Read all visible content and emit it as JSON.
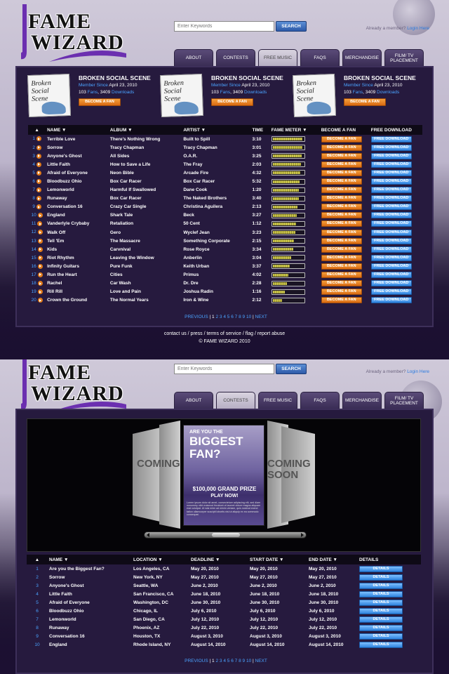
{
  "brand": {
    "line1": "FAME",
    "line2": "WIZARD"
  },
  "search": {
    "placeholder": "Enter Keywords",
    "button": "SEARCH"
  },
  "member": {
    "text": "Already a member?",
    "login": "Login Here"
  },
  "tabs": [
    {
      "label": "ABOUT"
    },
    {
      "label": "CONTESTS"
    },
    {
      "label": "FREE MUSIC"
    },
    {
      "label": "FAQS"
    },
    {
      "label": "MERCHANDISE"
    },
    {
      "label": "FILM/ TV PLACEMENT"
    }
  ],
  "music_page": {
    "active_tab": 2,
    "featured": [
      {
        "name": "BROKEN SOCIAL SCENE",
        "since_label": "Member Since",
        "since_date": "April 23, 2010",
        "fans": "103",
        "fans_label": "Fans",
        "downloads": "3409",
        "downloads_label": "Downloads",
        "button": "BECOME A FAN",
        "cover_text": "Broken Social Scene"
      },
      {
        "name": "BROKEN SOCIAL SCENE",
        "since_label": "Member Since",
        "since_date": "April 23, 2010",
        "fans": "103",
        "fans_label": "Fans",
        "downloads": "3409",
        "downloads_label": "Downloads",
        "button": "BECOME A FAN",
        "cover_text": "Broken Social Scene"
      },
      {
        "name": "BROKEN SOCIAL SCENE",
        "since_label": "Member Since",
        "since_date": "April 23, 2010",
        "fans": "103",
        "fans_label": "Fans",
        "downloads": "3409",
        "downloads_label": "Downloads",
        "button": "BECOME A FAN",
        "cover_text": "Broken Social Scene"
      }
    ],
    "columns": [
      "▲",
      "NAME ▼",
      "ALBUM ▼",
      "ARTIST ▼",
      "TIME",
      "FAME METER ▼",
      "BECOME A FAN",
      "FREE DOWNLOAD"
    ],
    "fan_button": "BECOME A FAN",
    "download_button": "FREE DOWNLOAD",
    "rows": [
      {
        "n": "1",
        "name": "Terrible Love",
        "album": "There's Nothing Wrong",
        "artist": "Built to Spill",
        "time": "3:10",
        "meter": 0.95
      },
      {
        "n": "2",
        "name": "Sorrow",
        "album": "Tracy Chapman",
        "artist": "Tracy Chapman",
        "time": "3:01",
        "meter": 0.95
      },
      {
        "n": "3",
        "name": "Anyone's Ghost",
        "album": "All Sides",
        "artist": "O.A.R.",
        "time": "3:25",
        "meter": 0.93
      },
      {
        "n": "4",
        "name": "Little Faith",
        "album": "How to Save a Life",
        "artist": "The Fray",
        "time": "2:03",
        "meter": 0.9
      },
      {
        "n": "5",
        "name": "Afraid of Everyone",
        "album": "Neon Bible",
        "artist": "Arcade Fire",
        "time": "4:32",
        "meter": 0.88
      },
      {
        "n": "6",
        "name": "Bloodbuzz Ohio",
        "album": "Box Car Racer",
        "artist": "Box Car Racer",
        "time": "5:32",
        "meter": 0.87
      },
      {
        "n": "7",
        "name": "Lemonworld",
        "album": "Harmful If Swallowed",
        "artist": "Dane Cook",
        "time": "1:20",
        "meter": 0.85
      },
      {
        "n": "8",
        "name": "Runaway",
        "album": "Box Car Racer",
        "artist": "The Naked Brothers",
        "time": "3:40",
        "meter": 0.83
      },
      {
        "n": "9",
        "name": "Conversation 16",
        "album": "Crazy Car Single",
        "artist": "Christina Aguilera",
        "time": "2:13",
        "meter": 0.8
      },
      {
        "n": "10",
        "name": "England",
        "album": "Shark Tale",
        "artist": "Beck",
        "time": "3:27",
        "meter": 0.78
      },
      {
        "n": "11",
        "name": "Vanderlyle Crybaby",
        "album": "Retaliation",
        "artist": "50 Cent",
        "time": "1:12",
        "meter": 0.75
      },
      {
        "n": "12",
        "name": "Walk Off",
        "album": "Gero",
        "artist": "Wyclef Jean",
        "time": "3:23",
        "meter": 0.72
      },
      {
        "n": "13",
        "name": "Tell 'Em",
        "album": "The Massacre",
        "artist": "Something Corporate",
        "time": "2:15",
        "meter": 0.68
      },
      {
        "n": "14",
        "name": "Kids",
        "album": "Carvnival",
        "artist": "Rose Royce",
        "time": "3:34",
        "meter": 0.65
      },
      {
        "n": "15",
        "name": "Riot Rhythm",
        "album": "Leaving the Window",
        "artist": "Anberlin",
        "time": "3:04",
        "meter": 0.6
      },
      {
        "n": "16",
        "name": "Infinity Guitars",
        "album": "Pure Funk",
        "artist": "Keith Urban",
        "time": "3:37",
        "meter": 0.55
      },
      {
        "n": "17",
        "name": "Run the Heart",
        "album": "Cities",
        "artist": "Primus",
        "time": "4:02",
        "meter": 0.5
      },
      {
        "n": "18",
        "name": "Rachel",
        "album": "Car Wash",
        "artist": "Dr. Dre",
        "time": "2:28",
        "meter": 0.45
      },
      {
        "n": "19",
        "name": "Rill Rill",
        "album": "Love and Pain",
        "artist": "Joshua Radin",
        "time": "1:16",
        "meter": 0.38
      },
      {
        "n": "20",
        "name": "Crown the Ground",
        "album": "The Normal Years",
        "artist": "Iron & Wine",
        "time": "2:12",
        "meter": 0.3
      }
    ],
    "pager": {
      "prev": "PREVIOUS",
      "pages": [
        "1",
        "2",
        "3",
        "4",
        "5",
        "6",
        "7",
        "8",
        "9",
        "10"
      ],
      "next": "NEXT"
    },
    "footer": {
      "links": "contact us / press / terms of service / flag / report abuse",
      "copyright": "© FAME WIZARD 2010"
    }
  },
  "contests_page": {
    "active_tab": 1,
    "poster": {
      "line1": "ARE YOU THE",
      "line2": "BIGGEST",
      "line3": "FAN?",
      "prize": "$100,000 GRAND PRIZE",
      "cta": "PLAY NOW!",
      "body": "Lorem ipsum dolor sit amet, consectetuer adipiscing elit, sed diam nonummy nibh euismod tincidunt ut laoreet dolore magna aliquam erat volutpat. Ut wisi enim ad minim veniam, quis nostrud exerci tation ullamcorper suscipit lobortis nisl ut aliquip ex ea commodo consequat."
    },
    "coming_soon": {
      "left": "COMING SOON",
      "right": "COMING SOON"
    },
    "columns": [
      "▲",
      "NAME ▼",
      "LOCATION ▼",
      "DEADLINE ▼",
      "START DATE ▼",
      "END DATE ▼",
      "DETAILS"
    ],
    "details_button": "DETAILS",
    "rows": [
      {
        "n": "1",
        "name": "Are you the Biggest Fan?",
        "location": "Los Angeles, CA",
        "deadline": "May 20, 2010",
        "start": "May 20, 2010",
        "end": "May 20, 2010"
      },
      {
        "n": "2",
        "name": "Sorrow",
        "location": "New York, NY",
        "deadline": "May 27, 2010",
        "start": "May 27, 2010",
        "end": "May 27, 2010"
      },
      {
        "n": "3",
        "name": "Anyone's Ghost",
        "location": "Seattle, WA",
        "deadline": "June 2, 2010",
        "start": "June 2, 2010",
        "end": "June 2, 2010"
      },
      {
        "n": "4",
        "name": "Little Faith",
        "location": "San Francisco, CA",
        "deadline": "June 18, 2010",
        "start": "June 18, 2010",
        "end": "June 18, 2010"
      },
      {
        "n": "5",
        "name": "Afraid of Everyone",
        "location": "Washington, DC",
        "deadline": "June 30, 2010",
        "start": "June 30, 2010",
        "end": "June 30, 2010"
      },
      {
        "n": "6",
        "name": "Bloodbuzz Ohio",
        "location": "Chicago, IL",
        "deadline": "July 6, 2010",
        "start": "July 6, 2010",
        "end": "July 6, 2010"
      },
      {
        "n": "7",
        "name": "Lemonworld",
        "location": "San Diego, CA",
        "deadline": "July 12, 2010",
        "start": "July 12, 2010",
        "end": "July 12, 2010"
      },
      {
        "n": "8",
        "name": "Runaway",
        "location": "Phoenix, AZ",
        "deadline": "July 22, 2010",
        "start": "July 22, 2010",
        "end": "July 22, 2010"
      },
      {
        "n": "9",
        "name": "Conversation 16",
        "location": "Houston, TX",
        "deadline": "August 3, 2010",
        "start": "August 3, 2010",
        "end": "August 3, 2010"
      },
      {
        "n": "10",
        "name": "England",
        "location": "Rhode Island, NY",
        "deadline": "August 14, 2010",
        "start": "August 14, 2010",
        "end": "August 14, 2010"
      }
    ],
    "pager": {
      "prev": "PREVIOUS",
      "pages": [
        "1",
        "2",
        "3",
        "4",
        "5",
        "6",
        "7",
        "8",
        "9",
        "10"
      ],
      "next": "NEXT"
    }
  }
}
